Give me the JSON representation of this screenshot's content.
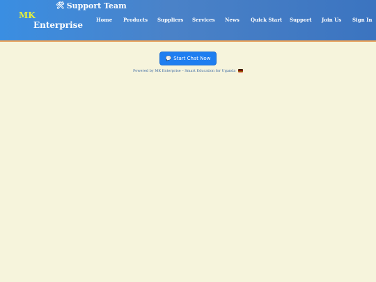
{
  "header": {
    "logo_line1": "MK",
    "logo_line2": "Enterprise",
    "support_title": "Support Team",
    "support_icon": "hammer-wrench-icon"
  },
  "nav": {
    "items": [
      {
        "label": "Home"
      },
      {
        "label": "Products"
      },
      {
        "label": "Suppliers"
      },
      {
        "label": "Services"
      },
      {
        "label": "News"
      },
      {
        "label": "Quick Start"
      },
      {
        "label": "Support"
      },
      {
        "label": "Join Us"
      },
      {
        "label": "Sign In"
      }
    ]
  },
  "main": {
    "chat_button_label": "Start Chat Now",
    "chat_icon": "speech-bubble-icon",
    "powered_by": "Powered by MK Enterprise – Smart Education for Uganda",
    "flag_icon": "uganda-flag-icon"
  },
  "colors": {
    "header_gradient_start": "#3a8ee2",
    "header_gradient_end": "#3b74c0",
    "logo_accent": "#e6f13a",
    "page_background": "#f6f4dc",
    "button_blue": "#1e7ef0",
    "header_border": "#e8a15a"
  }
}
